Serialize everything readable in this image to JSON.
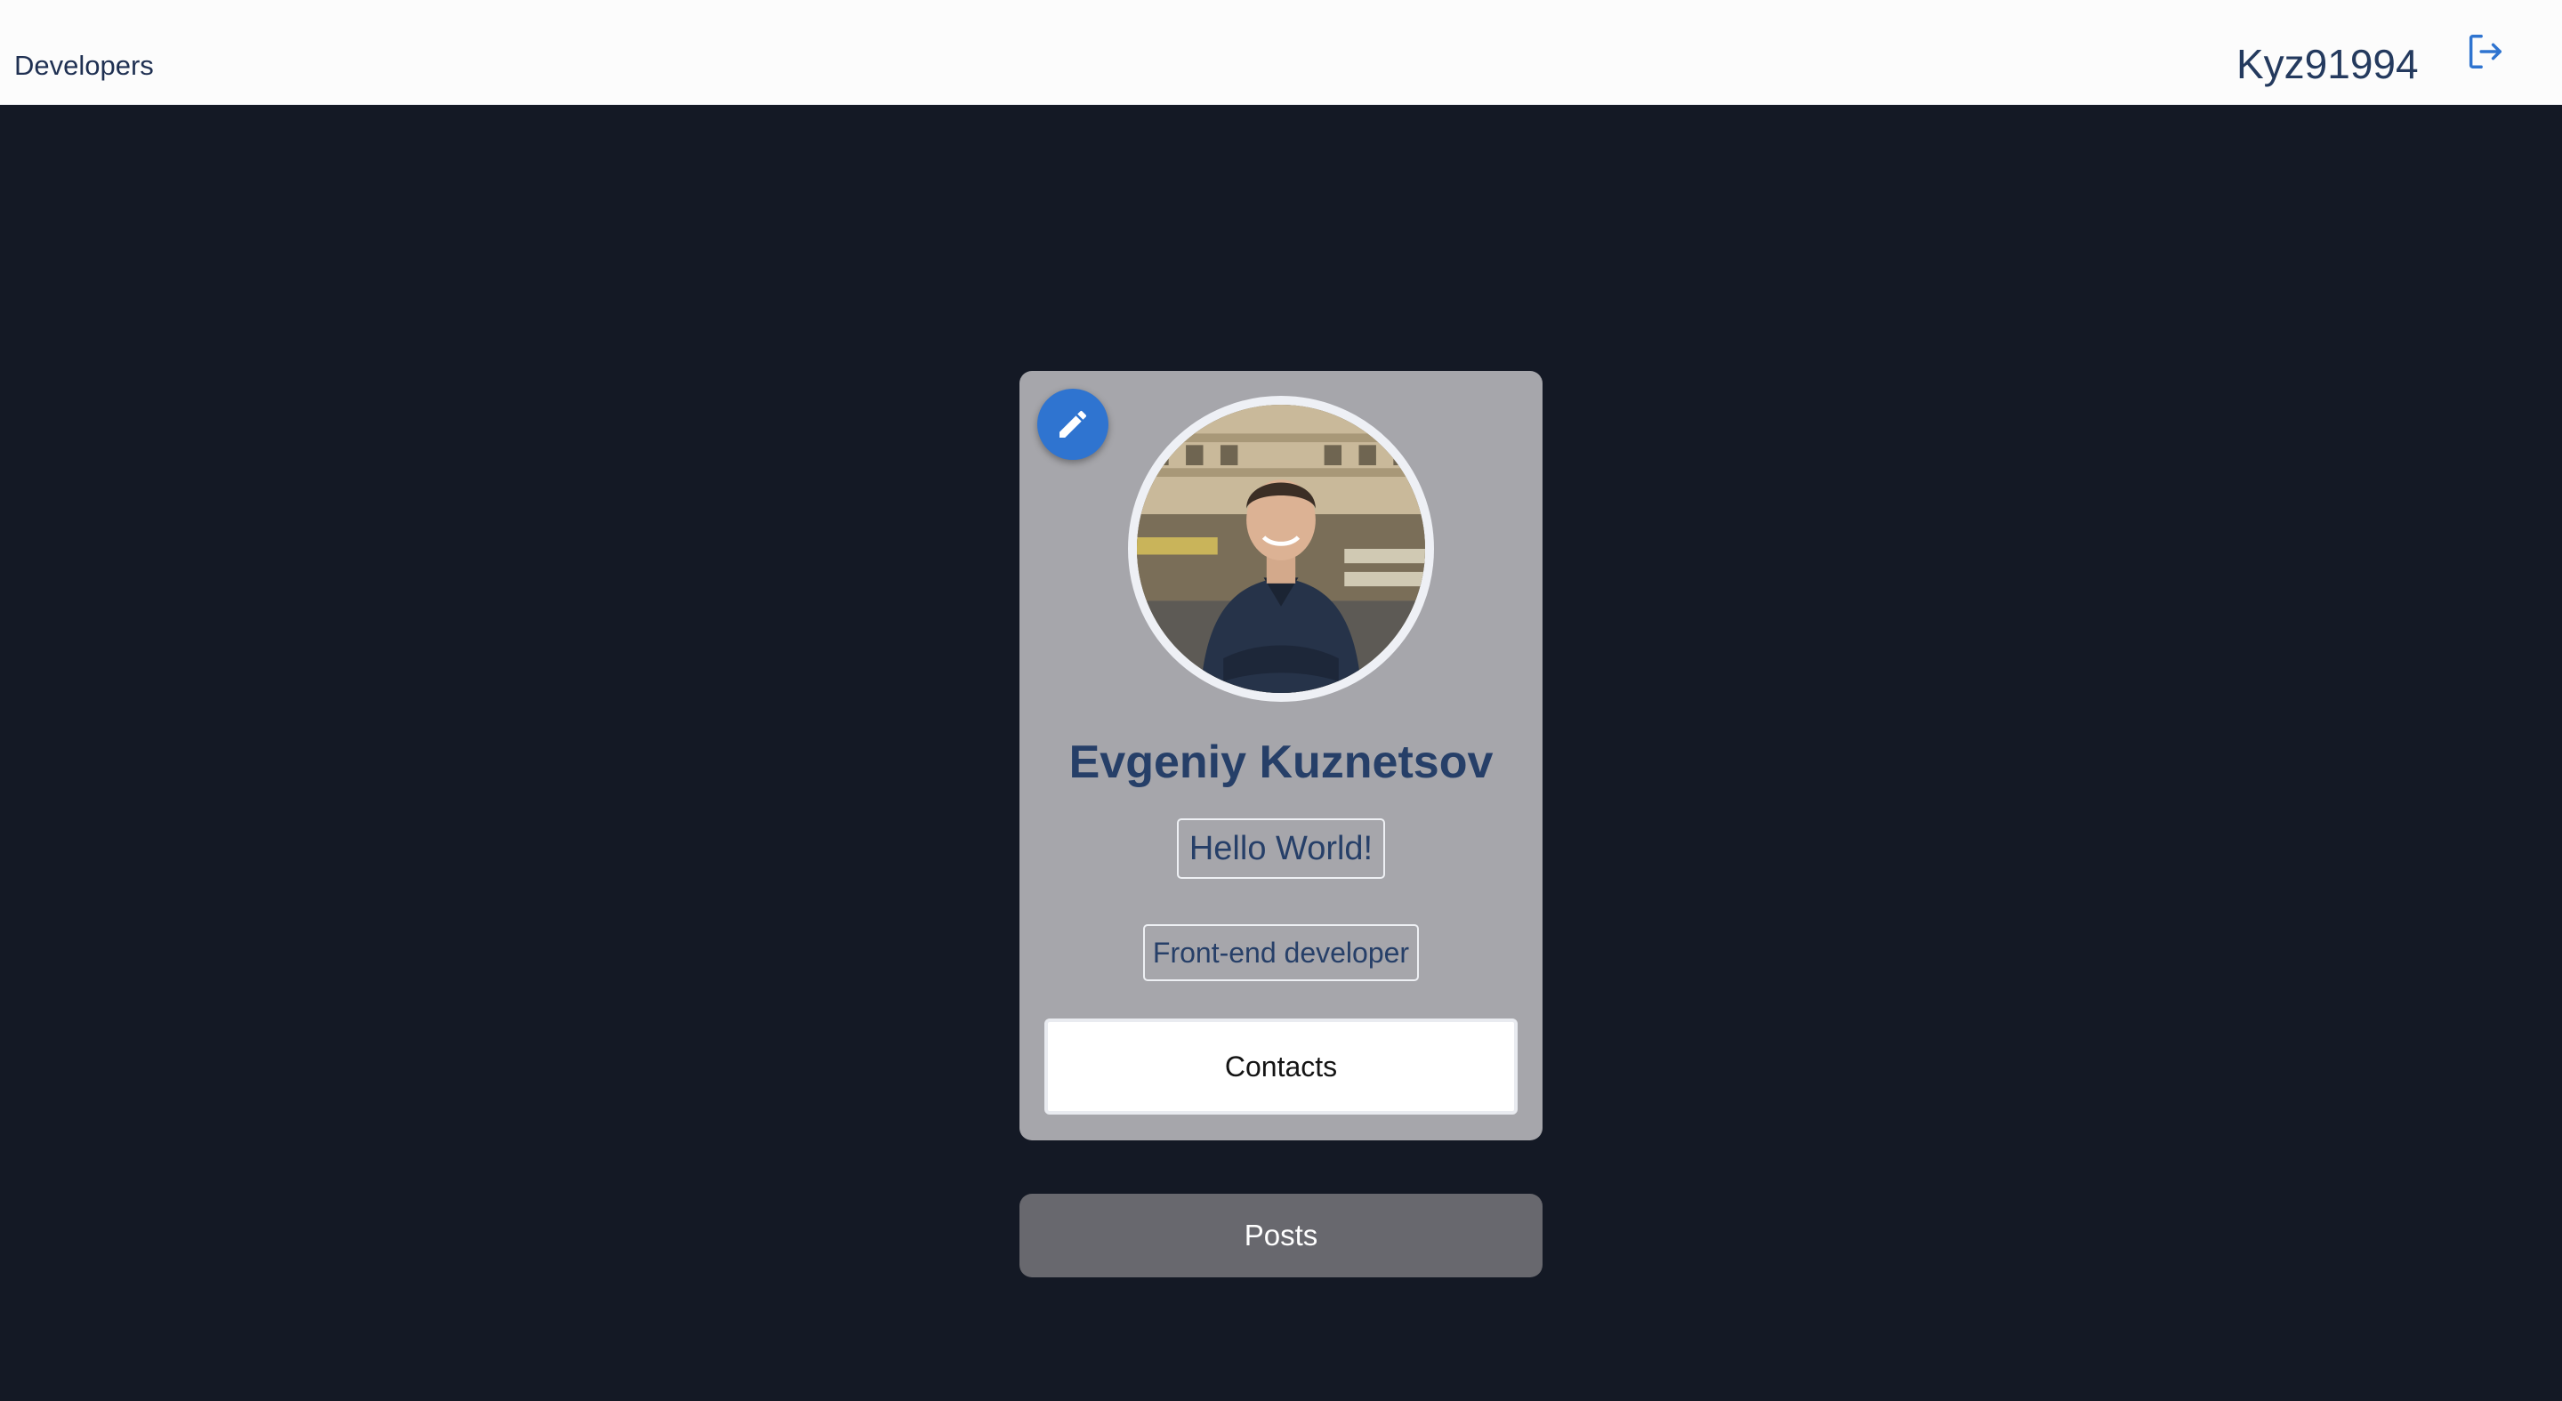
{
  "header": {
    "nav_link": "Developers",
    "username": "Kyz91994",
    "logout_icon": "logout-icon"
  },
  "profile": {
    "edit_icon": "pencil-icon",
    "avatar_alt": "profile photo",
    "name": "Evgeniy Kuznetsov",
    "status": "Hello World!",
    "job": "Front-end developer",
    "contacts_label": "Contacts"
  },
  "posts_label": "Posts",
  "colors": {
    "background": "#141925",
    "card": "#a6a6ab",
    "accent": "#2f74d0",
    "name_text": "#263f68"
  }
}
